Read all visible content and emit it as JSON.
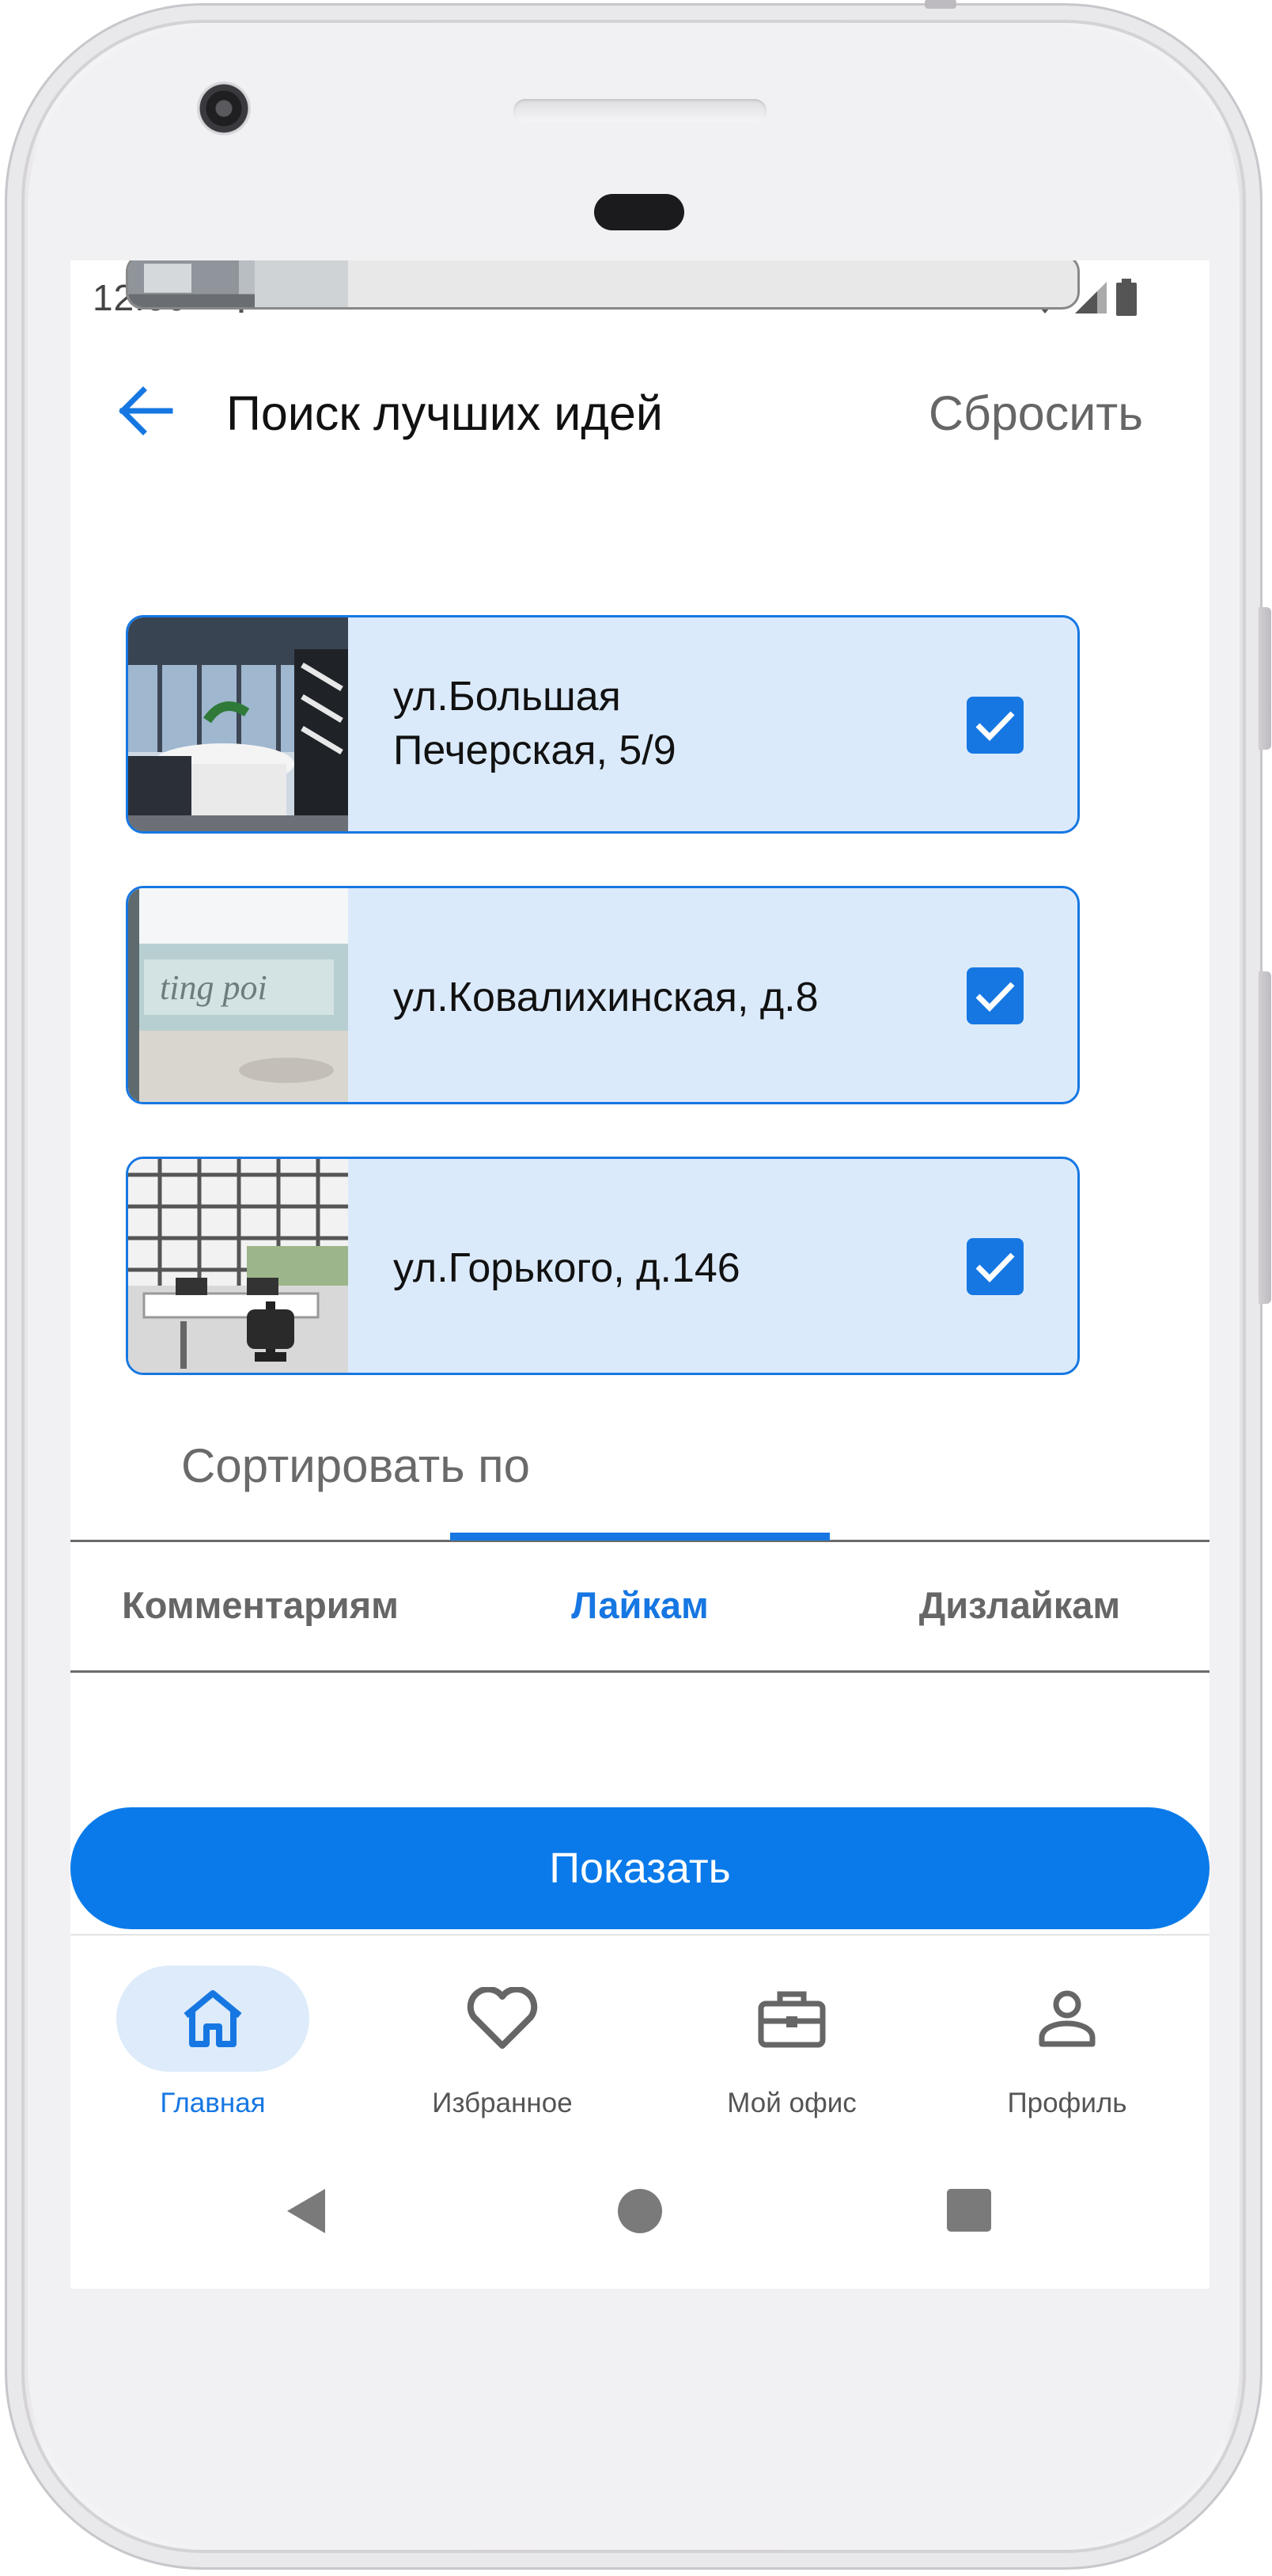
{
  "status_bar": {
    "time": "12:00"
  },
  "app_bar": {
    "title": "Поиск лучших идей",
    "reset_label": "Сбросить"
  },
  "offices": [
    {
      "address": "",
      "checked": false
    },
    {
      "address": "ул.Большая\nПечерская, 5/9",
      "checked": true
    },
    {
      "address": "ул.Ковалихинская, д.8",
      "checked": true
    },
    {
      "address": "ул.Горького, д.146",
      "checked": true
    }
  ],
  "sort": {
    "title": "Сортировать по",
    "tabs": [
      "Комментариям",
      "Лайкам",
      "Дизлайкам"
    ],
    "active_tab": "Лайкам"
  },
  "show_button": {
    "label": "Показать"
  },
  "bottom_nav": {
    "items": [
      {
        "label": "Главная",
        "icon": "home-icon",
        "active": true
      },
      {
        "label": "Избранное",
        "icon": "heart-icon",
        "active": false
      },
      {
        "label": "Мой офис",
        "icon": "briefcase-icon",
        "active": false
      },
      {
        "label": "Профиль",
        "icon": "person-icon",
        "active": false
      }
    ]
  },
  "colors": {
    "accent": "#1677e2",
    "card_bg": "#dbeafb",
    "button": "#0a7aea"
  }
}
